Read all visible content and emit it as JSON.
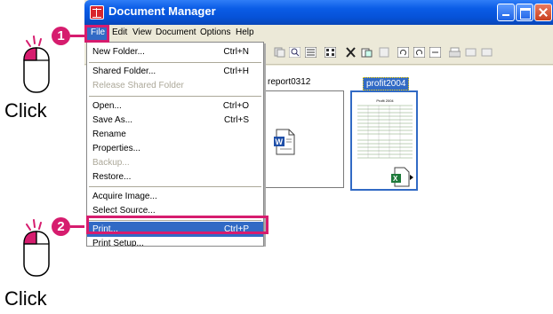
{
  "guide": {
    "steps": [
      "1",
      "2"
    ],
    "click_label": "Click",
    "accent_color": "#d61c6e"
  },
  "window": {
    "title": "Document Manager",
    "controls": [
      "minimize-icon",
      "maximize-icon",
      "close-icon"
    ]
  },
  "menubar": {
    "items": [
      "File",
      "Edit",
      "View",
      "Document",
      "Options",
      "Help"
    ]
  },
  "file_menu": {
    "items": [
      {
        "label": "New Folder...",
        "shortcut": "Ctrl+N",
        "disabled": false
      },
      {
        "label": "Shared Folder...",
        "shortcut": "Ctrl+H",
        "disabled": false
      },
      {
        "label": "Release Shared Folder",
        "shortcut": "",
        "disabled": true
      },
      {
        "label": "Open...",
        "shortcut": "Ctrl+O",
        "disabled": false
      },
      {
        "label": "Save As...",
        "shortcut": "Ctrl+S",
        "disabled": false
      },
      {
        "label": "Rename",
        "shortcut": "",
        "disabled": false
      },
      {
        "label": "Properties...",
        "shortcut": "",
        "disabled": false
      },
      {
        "label": "Backup...",
        "shortcut": "",
        "disabled": true
      },
      {
        "label": "Restore...",
        "shortcut": "",
        "disabled": false
      },
      {
        "label": "Acquire Image...",
        "shortcut": "",
        "disabled": false
      },
      {
        "label": "Select Source...",
        "shortcut": "",
        "disabled": false
      },
      {
        "label": "Print...",
        "shortcut": "Ctrl+P",
        "disabled": false,
        "selected": true
      },
      {
        "label": "Print Setup...",
        "shortcut": "",
        "disabled": false
      }
    ]
  },
  "documents": [
    {
      "name": "report0312",
      "type": "word-doc-icon",
      "selected": false
    },
    {
      "name": "profit2004",
      "type": "excel-sheet-icon",
      "selected": true,
      "preview_title": "Profit 2004"
    }
  ]
}
